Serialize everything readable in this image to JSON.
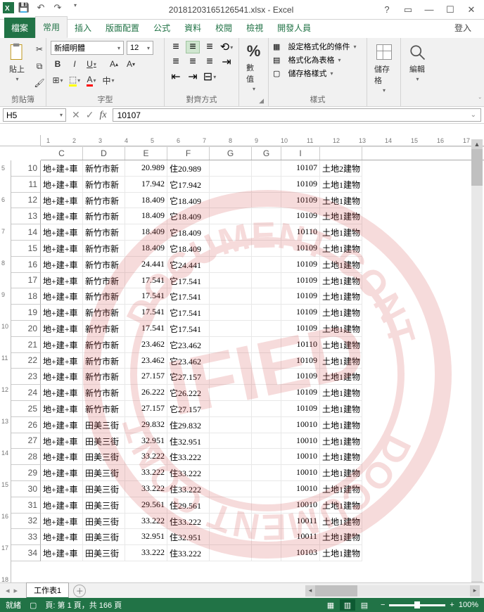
{
  "title": "20181203165126541.xlsx - Excel",
  "tabs": {
    "file": "檔案",
    "home": "常用",
    "insert": "插入",
    "layout": "版面配置",
    "formulas": "公式",
    "data": "資料",
    "review": "校閱",
    "view": "檢視",
    "dev": "開發人員",
    "login": "登入"
  },
  "ribbon": {
    "clipboard": {
      "paste": "貼上",
      "label": "剪貼簿"
    },
    "font": {
      "name": "新細明體",
      "size": "12",
      "label": "字型"
    },
    "align": {
      "wrap": "",
      "merge": "",
      "label": "對齊方式"
    },
    "number": {
      "label": "數值",
      "btn": "%"
    },
    "styles": {
      "cond": "設定格式化的條件",
      "table": "格式化為表格",
      "cell": "儲存格樣式",
      "label": "樣式"
    },
    "cells": {
      "cells": "儲存格",
      "label": ""
    },
    "editing": {
      "edit": "編輯",
      "label": ""
    }
  },
  "namebox": "H5",
  "formula": "10107",
  "columns": [
    "C",
    "D",
    "E",
    "F",
    "G",
    "G",
    "I",
    ""
  ],
  "ruler_h": [
    1,
    2,
    3,
    4,
    5,
    6,
    7,
    8,
    9,
    10,
    11,
    12,
    13,
    14,
    15,
    16,
    17
  ],
  "ruler_v": [
    5,
    6,
    7,
    8,
    9,
    10,
    11,
    12,
    13,
    14,
    15,
    16,
    17,
    18
  ],
  "rows": [
    {
      "n": 10,
      "c": "地+建+車",
      "d": "新竹市新",
      "e": "20.989",
      "f": "住20.989",
      "i": "10107",
      "j": "土地2建物"
    },
    {
      "n": 11,
      "c": "地+建+車",
      "d": "新竹市新",
      "e": "17.942",
      "f": "它17.942",
      "i": "10109",
      "j": "土地1建物"
    },
    {
      "n": 12,
      "c": "地+建+車",
      "d": "新竹市新",
      "e": "18.409",
      "f": "它18.409",
      "i": "10109",
      "j": "土地1建物"
    },
    {
      "n": 13,
      "c": "地+建+車",
      "d": "新竹市新",
      "e": "18.409",
      "f": "它18.409",
      "i": "10109",
      "j": "土地1建物"
    },
    {
      "n": 14,
      "c": "地+建+車",
      "d": "新竹市新",
      "e": "18.409",
      "f": "它18.409",
      "i": "10110",
      "j": "土地1建物"
    },
    {
      "n": 15,
      "c": "地+建+車",
      "d": "新竹市新",
      "e": "18.409",
      "f": "它18.409",
      "i": "10109",
      "j": "土地1建物"
    },
    {
      "n": 16,
      "c": "地+建+車",
      "d": "新竹市新",
      "e": "24.441",
      "f": "它24.441",
      "i": "10109",
      "j": "土地1建物"
    },
    {
      "n": 17,
      "c": "地+建+車",
      "d": "新竹市新",
      "e": "17.541",
      "f": "它17.541",
      "i": "10109",
      "j": "土地1建物"
    },
    {
      "n": 18,
      "c": "地+建+車",
      "d": "新竹市新",
      "e": "17.541",
      "f": "它17.541",
      "i": "10109",
      "j": "土地1建物"
    },
    {
      "n": 19,
      "c": "地+建+車",
      "d": "新竹市新",
      "e": "17.541",
      "f": "它17.541",
      "i": "10109",
      "j": "土地1建物"
    },
    {
      "n": 20,
      "c": "地+建+車",
      "d": "新竹市新",
      "e": "17.541",
      "f": "它17.541",
      "i": "10109",
      "j": "土地1建物"
    },
    {
      "n": 21,
      "c": "地+建+車",
      "d": "新竹市新",
      "e": "23.462",
      "f": "它23.462",
      "i": "10110",
      "j": "土地1建物"
    },
    {
      "n": 22,
      "c": "地+建+車",
      "d": "新竹市新",
      "e": "23.462",
      "f": "它23.462",
      "i": "10109",
      "j": "土地1建物"
    },
    {
      "n": 23,
      "c": "地+建+車",
      "d": "新竹市新",
      "e": "27.157",
      "f": "它27.157",
      "i": "10109",
      "j": "土地1建物"
    },
    {
      "n": 24,
      "c": "地+建+車",
      "d": "新竹市新",
      "e": "26.222",
      "f": "它26.222",
      "i": "10109",
      "j": "土地1建物"
    },
    {
      "n": 25,
      "c": "地+建+車",
      "d": "新竹市新",
      "e": "27.157",
      "f": "它27.157",
      "i": "10109",
      "j": "土地1建物"
    },
    {
      "n": 26,
      "c": "地+建+車",
      "d": "田美三街",
      "e": "29.832",
      "f": "住29.832",
      "i": "10010",
      "j": "土地1建物"
    },
    {
      "n": 27,
      "c": "地+建+車",
      "d": "田美三街",
      "e": "32.951",
      "f": "住32.951",
      "i": "10010",
      "j": "土地1建物"
    },
    {
      "n": 28,
      "c": "地+建+車",
      "d": "田美三街",
      "e": "33.222",
      "f": "住33.222",
      "i": "10010",
      "j": "土地1建物"
    },
    {
      "n": 29,
      "c": "地+建+車",
      "d": "田美三街",
      "e": "33.222",
      "f": "住33.222",
      "i": "10010",
      "j": "土地1建物"
    },
    {
      "n": 30,
      "c": "地+建+車",
      "d": "田美三街",
      "e": "33.222",
      "f": "住33.222",
      "i": "10010",
      "j": "土地1建物"
    },
    {
      "n": 31,
      "c": "地+建+車",
      "d": "田美三街",
      "e": "29.561",
      "f": "住29.561",
      "i": "10010",
      "j": "土地1建物"
    },
    {
      "n": 32,
      "c": "地+建+車",
      "d": "田美三街",
      "e": "33.222",
      "f": "住33.222",
      "i": "10011",
      "j": "土地1建物"
    },
    {
      "n": 33,
      "c": "地+建+車",
      "d": "田美三街",
      "e": "32.951",
      "f": "住32.951",
      "i": "10011",
      "j": "土地1建物"
    },
    {
      "n": 34,
      "c": "地+建+車",
      "d": "田美三街",
      "e": "33.222",
      "f": "住33.222",
      "i": "10103",
      "j": "土地1建物"
    }
  ],
  "sheet": {
    "name": "工作表1"
  },
  "status": {
    "ready": "就緒",
    "page": "頁: 第 1 頁，共 166 頁",
    "zoom": "100%"
  }
}
